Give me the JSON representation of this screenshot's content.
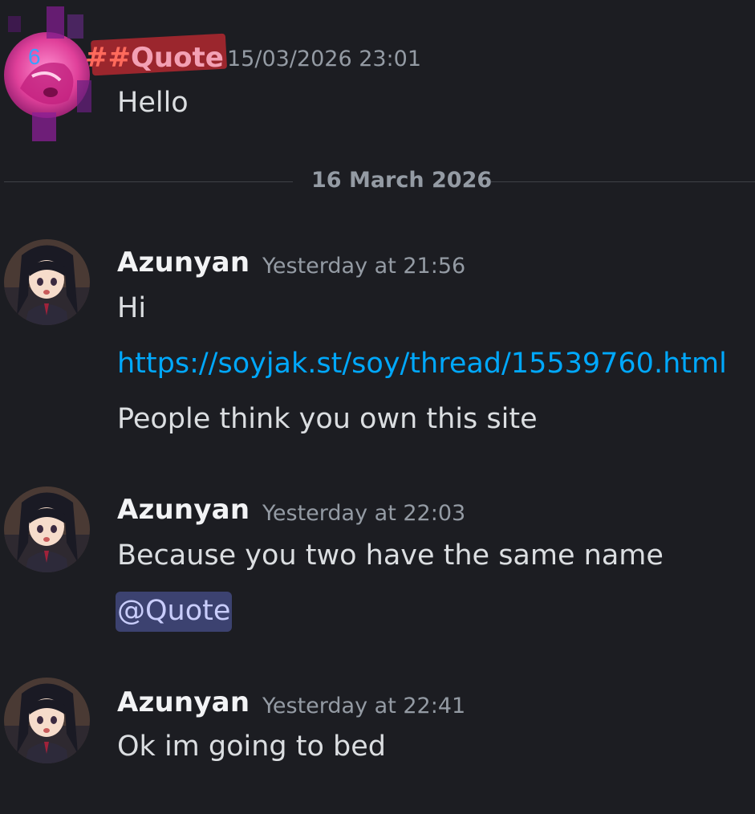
{
  "messages": [
    {
      "author": "Quote",
      "author_prefix": "##",
      "timestamp": "15/03/2026 23:01",
      "lines": [
        "Hello"
      ]
    },
    {
      "author": "Azunyan",
      "timestamp": "Yesterday at 21:56",
      "lines": [
        "Hi",
        "https://soyjak.st/soy/thread/15539760.html",
        "People think you own this site"
      ]
    },
    {
      "author": "Azunyan",
      "timestamp": "Yesterday at 22:03",
      "lines": [
        "Because you two have the same name",
        "@Quote"
      ]
    },
    {
      "author": "Azunyan",
      "timestamp": "Yesterday at 22:41",
      "lines": [
        "Ok im going to bed"
      ]
    }
  ],
  "date_divider": "16 March 2026",
  "colors": {
    "background": "#1c1d22",
    "link": "#00a8fc",
    "mention_bg": "#3c4270",
    "mention_text": "#c9cdfb",
    "quote_name": "#f3a0b4",
    "quote_name_scribble": "#d6312c"
  },
  "icons": {
    "avatar_quote": "scribbled-pink-avatar-icon",
    "avatar_azunyan": "anime-girl-avatar-icon"
  }
}
